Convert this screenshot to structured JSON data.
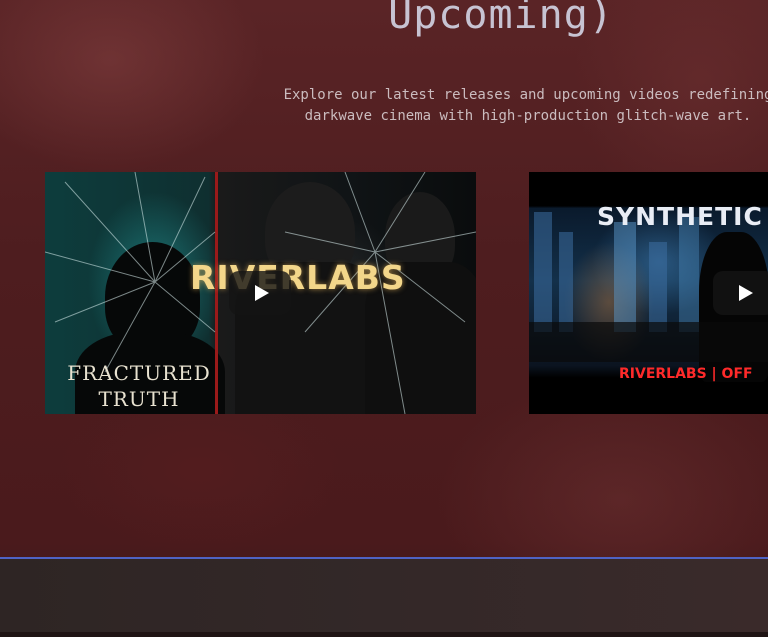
{
  "section": {
    "title": "Upcoming)",
    "description_line1": "Explore our latest releases and upcoming videos redefining",
    "description_line2": "darkwave cinema with high-production glitch-wave art."
  },
  "videos": [
    {
      "brand": "RIVERLABS",
      "title_line1": "FRACTURED",
      "title_line2": "TRUTH",
      "play_icon": "play-icon"
    },
    {
      "brand": "SYNTHETIC",
      "caption": "RIVERLABS | OFF",
      "play_icon": "play-icon"
    }
  ],
  "colors": {
    "background": "#4a1a1c",
    "footer_border": "#4f63c4",
    "title_text": "#c7c3d2",
    "brand_red": "#ff2a2a"
  }
}
